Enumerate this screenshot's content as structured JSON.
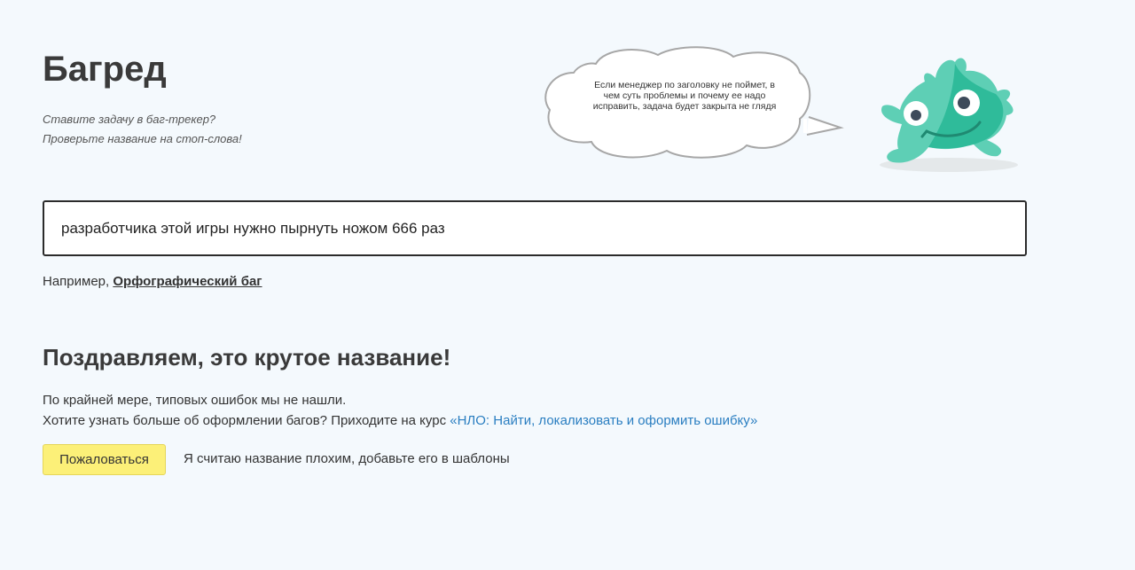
{
  "header": {
    "title": "Багред",
    "subtitle_line1": "Ставите задачу в баг-трекер?",
    "subtitle_line2": "Проверьте название на стоп-слова!"
  },
  "speech_bubble": {
    "text": "Если менеджер по заголовку не поймет, в чем суть проблемы и почему ее надо исправить, задача будет закрыта не глядя"
  },
  "mascot": {
    "icon": "green-monster-mascot-icon",
    "colors": {
      "body": "#5ecfb5",
      "body_dark": "#2fbb9a",
      "eye": "#ffffff",
      "pupil": "#3d4a5a"
    }
  },
  "search": {
    "value": "разработчика этой игры нужно пырнуть ножом 666 раз",
    "placeholder": ""
  },
  "example": {
    "prefix": "Например, ",
    "link": "Орфографический баг"
  },
  "result": {
    "title": "Поздравляем, это крутое название!",
    "line1": "По крайней мере, типовых ошибок мы не нашли.",
    "line2_prefix": "Хотите узнать больше об оформлении багов? Приходите на курс ",
    "course_link": "«НЛО: Найти, локализовать и оформить ошибку»"
  },
  "actions": {
    "complain_label": "Пожаловаться",
    "bad_name_text": "Я считаю название плохим, добавьте его в шаблоны"
  },
  "colors": {
    "background": "#f4f9fd",
    "button_yellow": "#fcf078",
    "link_blue": "#2a7ec1"
  }
}
